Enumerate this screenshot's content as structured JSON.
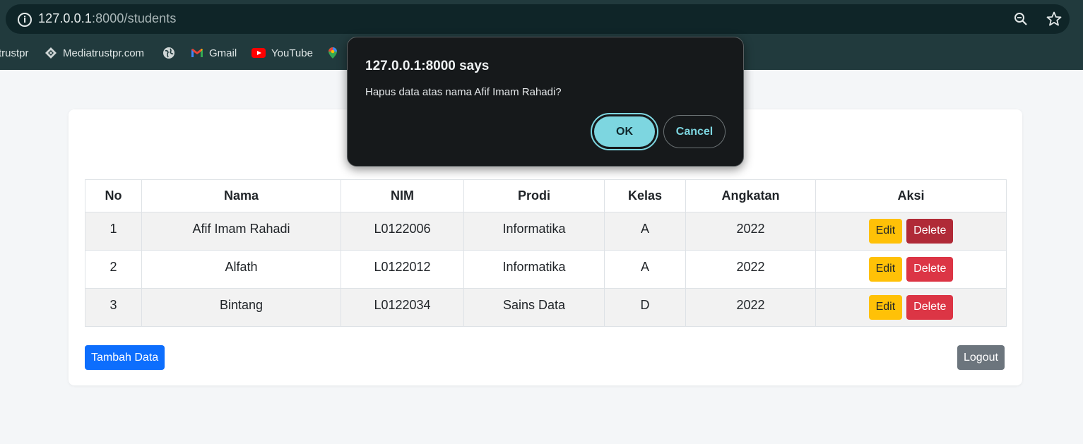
{
  "browser": {
    "url_host": "127.0.0.1",
    "url_rest": ":8000/students",
    "bookmarks": [
      {
        "label": "trustpr",
        "icon": "globe-icon"
      },
      {
        "label": "Mediatrustpr.com",
        "icon": "mediatrust-icon"
      },
      {
        "label": "",
        "icon": "globe-icon"
      },
      {
        "label": "Gmail",
        "icon": "gmail-icon"
      },
      {
        "label": "YouTube",
        "icon": "youtube-icon"
      },
      {
        "label": "",
        "icon": "maps-icon"
      }
    ]
  },
  "dialog": {
    "title": "127.0.0.1:8000 says",
    "message": "Hapus data atas nama Afif Imam Rahadi?",
    "ok_label": "OK",
    "cancel_label": "Cancel"
  },
  "table": {
    "headers": [
      "No",
      "Nama",
      "NIM",
      "Prodi",
      "Kelas",
      "Angkatan",
      "Aksi"
    ],
    "rows": [
      {
        "no": "1",
        "nama": "Afif Imam Rahadi",
        "nim": "L0122006",
        "prodi": "Informatika",
        "kelas": "A",
        "angkatan": "2022"
      },
      {
        "no": "2",
        "nama": "Alfath",
        "nim": "L0122012",
        "prodi": "Informatika",
        "kelas": "A",
        "angkatan": "2022"
      },
      {
        "no": "3",
        "nama": "Bintang",
        "nim": "L0122034",
        "prodi": "Sains Data",
        "kelas": "D",
        "angkatan": "2022"
      }
    ],
    "edit_label": "Edit",
    "delete_label": "Delete"
  },
  "actions": {
    "add_label": "Tambah Data",
    "logout_label": "Logout"
  },
  "colors": {
    "primary": "#0d6efd",
    "warning": "#ffc107",
    "danger": "#dc3545",
    "secondary": "#6c757d",
    "dialog_accent": "#7dd6e0"
  }
}
